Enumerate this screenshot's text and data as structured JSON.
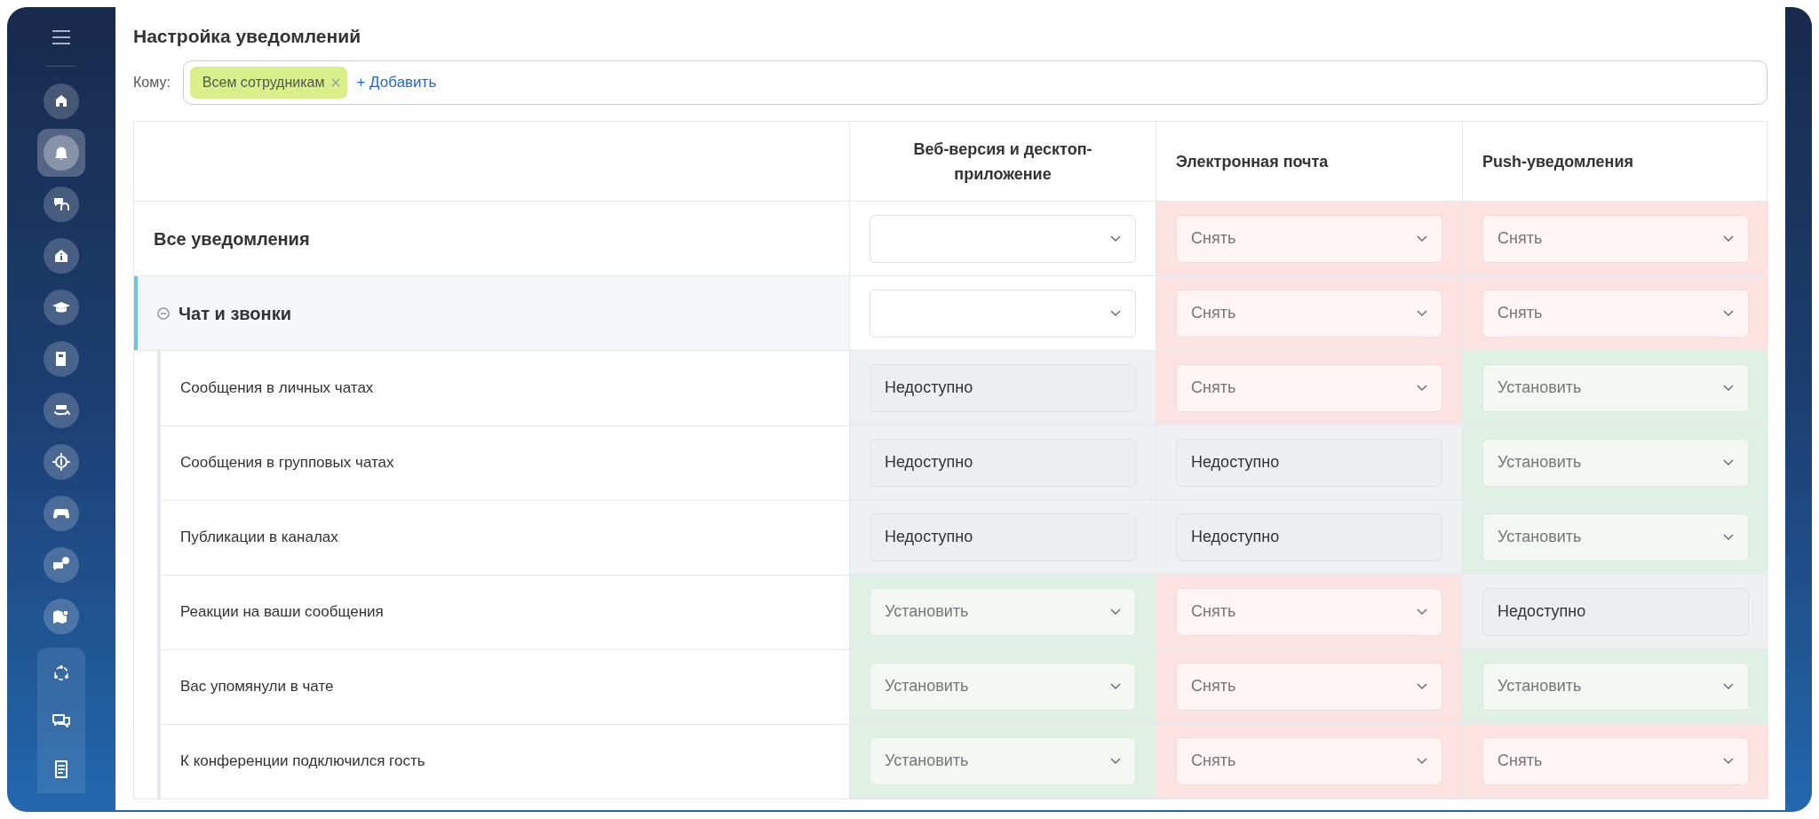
{
  "sidebar": {
    "items": [
      {
        "selected": false
      },
      {
        "selected": true
      },
      {
        "selected": false
      },
      {
        "selected": false
      },
      {
        "selected": false
      },
      {
        "selected": false
      },
      {
        "selected": false
      },
      {
        "selected": false
      },
      {
        "selected": false
      },
      {
        "selected": false
      },
      {
        "selected": false
      }
    ],
    "group_items": [
      {
        "selected": false
      },
      {
        "selected": false
      },
      {
        "selected": false
      }
    ]
  },
  "title": "Настройка уведомлений",
  "recipients": {
    "label": "Кому:",
    "chips": [
      "Всем сотрудникам"
    ],
    "add_link": "+ Добавить"
  },
  "table": {
    "columns": [
      "Веб-версия и десктоп-приложение",
      "Электронная почта",
      "Push-уведомления"
    ],
    "rows": [
      {
        "label": "Все уведомления",
        "cells": [
          {
            "kind": "mixed"
          },
          {
            "kind": "unset",
            "value": "Снять"
          },
          {
            "kind": "unset",
            "value": "Снять"
          }
        ]
      },
      {
        "label": "Чат и звонки",
        "expanded": true,
        "cells": [
          {
            "kind": "mixed"
          },
          {
            "kind": "unset",
            "value": "Снять"
          },
          {
            "kind": "unset",
            "value": "Снять"
          }
        ],
        "children": [
          {
            "label": "Сообщения в личных чатах",
            "cells": [
              {
                "kind": "unavailable",
                "value": "Недоступно"
              },
              {
                "kind": "unset",
                "value": "Снять"
              },
              {
                "kind": "set",
                "value": "Установить"
              }
            ]
          },
          {
            "label": "Сообщения в групповых чатах",
            "cells": [
              {
                "kind": "unavailable",
                "value": "Недоступно"
              },
              {
                "kind": "unavailable",
                "value": "Недоступно"
              },
              {
                "kind": "set",
                "value": "Установить"
              }
            ]
          },
          {
            "label": "Публикации в каналах",
            "cells": [
              {
                "kind": "unavailable",
                "value": "Недоступно"
              },
              {
                "kind": "unavailable",
                "value": "Недоступно"
              },
              {
                "kind": "set",
                "value": "Установить"
              }
            ]
          },
          {
            "label": "Реакции на ваши сообщения",
            "cells": [
              {
                "kind": "set",
                "value": "Установить"
              },
              {
                "kind": "unset",
                "value": "Снять"
              },
              {
                "kind": "unavailable",
                "value": "Недоступно"
              }
            ]
          },
          {
            "label": "Вас упомянули в чате",
            "cells": [
              {
                "kind": "set",
                "value": "Установить"
              },
              {
                "kind": "unset",
                "value": "Снять"
              },
              {
                "kind": "set",
                "value": "Установить"
              }
            ]
          },
          {
            "label": "К конференции подключился гость",
            "cells": [
              {
                "kind": "set",
                "value": "Установить"
              },
              {
                "kind": "unset",
                "value": "Снять"
              },
              {
                "kind": "unset",
                "value": "Снять"
              }
            ]
          }
        ]
      }
    ]
  }
}
